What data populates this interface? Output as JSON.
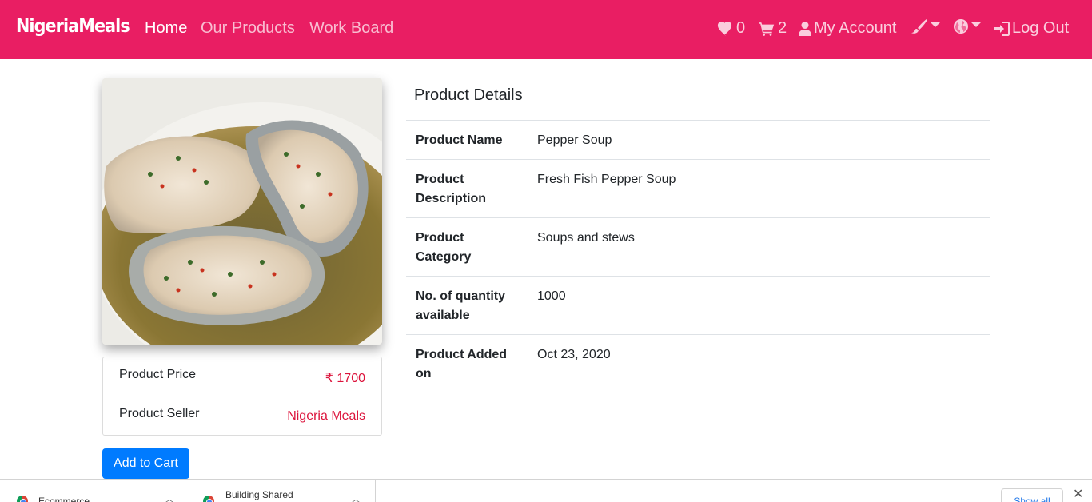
{
  "navbar": {
    "brand": "NigeriaMeals",
    "links": [
      {
        "label": "Home",
        "active": true
      },
      {
        "label": "Our Products",
        "active": false
      },
      {
        "label": "Work Board",
        "active": false
      }
    ],
    "wishlist_count": "0",
    "cart_count": "2",
    "account_label": "My Account",
    "logout_label": "Log Out",
    "bg_color": "#e91e63"
  },
  "product": {
    "info": {
      "price_label": "Product Price",
      "price_value": "₹ 1700",
      "seller_label": "Product Seller",
      "seller_value": "Nigeria Meals"
    },
    "add_to_cart_label": "Add to Cart"
  },
  "details": {
    "title": "Product Details",
    "rows": [
      {
        "key": "Product Name",
        "value": "Pepper Soup"
      },
      {
        "key": "Product Description",
        "value": "Fresh Fish Pepper Soup"
      },
      {
        "key": "Product Category",
        "value": "Soups and stews"
      },
      {
        "key": "No. of quantity available",
        "value": "1000"
      },
      {
        "key": "Product Added on",
        "value": "Oct 23, 2020"
      }
    ]
  },
  "downloads": {
    "items": [
      {
        "name": "Ecommerce"
      },
      {
        "name": "Building Shared"
      }
    ],
    "show_all_label": "Show all"
  },
  "colors": {
    "accent": "#e91e63",
    "price": "#dc143c",
    "button": "#007bff"
  }
}
